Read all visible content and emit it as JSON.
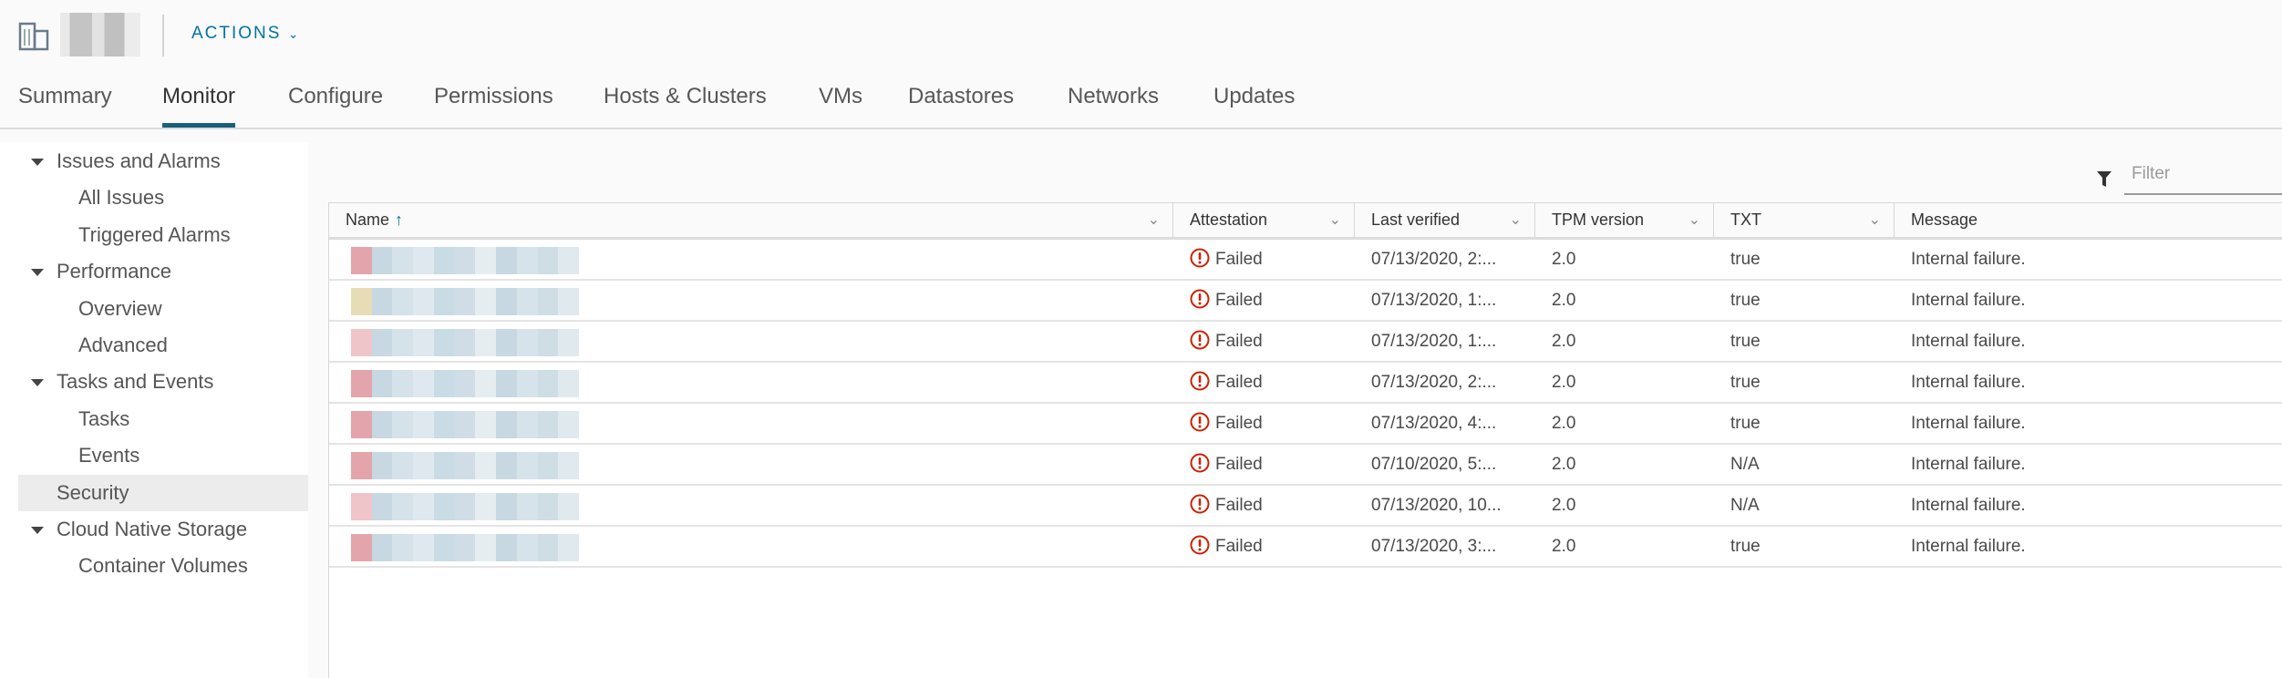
{
  "header": {
    "actions_label": "ACTIONS"
  },
  "tabs": [
    {
      "label": "Summary"
    },
    {
      "label": "Monitor",
      "active": true
    },
    {
      "label": "Configure"
    },
    {
      "label": "Permissions"
    },
    {
      "label": "Hosts & Clusters"
    },
    {
      "label": "VMs"
    },
    {
      "label": "Datastores"
    },
    {
      "label": "Networks"
    },
    {
      "label": "Updates"
    }
  ],
  "sidebar": {
    "items": [
      {
        "label": "Issues and Alarms",
        "group": true
      },
      {
        "label": "All Issues"
      },
      {
        "label": "Triggered Alarms"
      },
      {
        "label": "Performance",
        "group": true
      },
      {
        "label": "Overview"
      },
      {
        "label": "Advanced"
      },
      {
        "label": "Tasks and Events",
        "group": true
      },
      {
        "label": "Tasks"
      },
      {
        "label": "Events"
      },
      {
        "label": "Security",
        "selected": true
      },
      {
        "label": "Cloud Native Storage",
        "group": true
      },
      {
        "label": "Container Volumes"
      }
    ]
  },
  "filter": {
    "placeholder": "Filter"
  },
  "table": {
    "columns": [
      "Name",
      "Attestation",
      "Last verified",
      "TPM version",
      "TXT",
      "Message"
    ],
    "rows": [
      {
        "attestation": "Failed",
        "last_verified": "07/13/2020, 2:...",
        "tpm": "2.0",
        "txt": "true",
        "message": "Internal failure."
      },
      {
        "attestation": "Failed",
        "last_verified": "07/13/2020, 1:...",
        "tpm": "2.0",
        "txt": "true",
        "message": "Internal failure."
      },
      {
        "attestation": "Failed",
        "last_verified": "07/13/2020, 1:...",
        "tpm": "2.0",
        "txt": "true",
        "message": "Internal failure."
      },
      {
        "attestation": "Failed",
        "last_verified": "07/13/2020, 2:...",
        "tpm": "2.0",
        "txt": "true",
        "message": "Internal failure."
      },
      {
        "attestation": "Failed",
        "last_verified": "07/13/2020, 4:...",
        "tpm": "2.0",
        "txt": "true",
        "message": "Internal failure."
      },
      {
        "attestation": "Failed",
        "last_verified": "07/10/2020, 5:...",
        "tpm": "2.0",
        "txt": "N/A",
        "message": "Internal failure."
      },
      {
        "attestation": "Failed",
        "last_verified": "07/13/2020, 10...",
        "tpm": "2.0",
        "txt": "N/A",
        "message": "Internal failure."
      },
      {
        "attestation": "Failed",
        "last_verified": "07/13/2020, 3:...",
        "tpm": "2.0",
        "txt": "true",
        "message": "Internal failure."
      }
    ]
  },
  "colors": {
    "accent": "#0072a3",
    "tab_underline": "#1b5f7c",
    "error": "#c92100"
  }
}
